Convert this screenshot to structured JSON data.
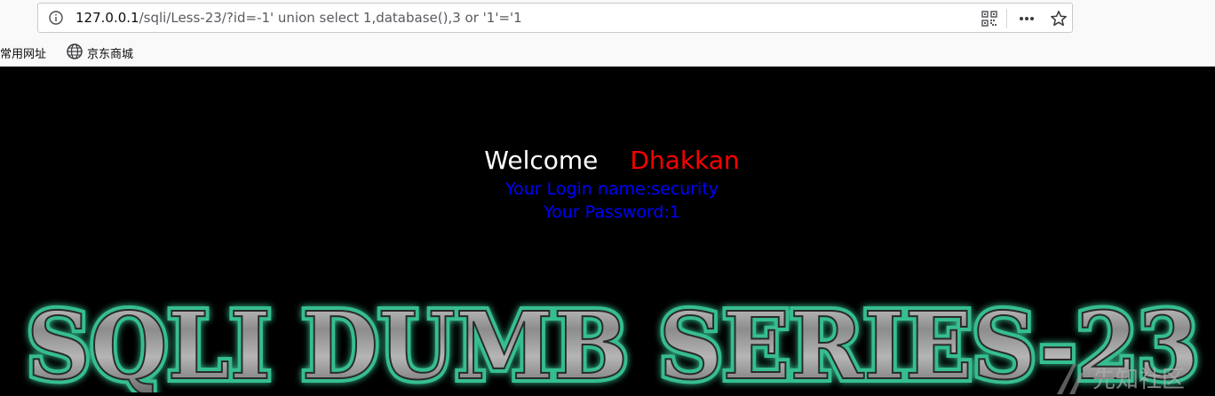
{
  "browser": {
    "url_host": "127.0.0.1",
    "url_path": "/sqli/Less-23/?id=-1' union select 1,database(),3 or '1'='1",
    "icons": [
      "info-icon",
      "qr-code-icon",
      "more-icon",
      "star-icon",
      "globe-icon"
    ]
  },
  "bookmarks": {
    "common_sites": "常用网址",
    "jd_mall": "京东商城"
  },
  "page": {
    "welcome": "Welcome",
    "name": "Dhakkan",
    "login_line": "Your Login name:security",
    "password_line": "Your Password:1",
    "banner_text": "SQLI DUMB SERIES-23",
    "watermark": "先知社区"
  },
  "colors": {
    "page_background": "#000000",
    "welcome_color": "#ffffff",
    "name_color": "#ff0000",
    "info_color": "#0000ff",
    "banner_glow": "#3fe0a8"
  }
}
